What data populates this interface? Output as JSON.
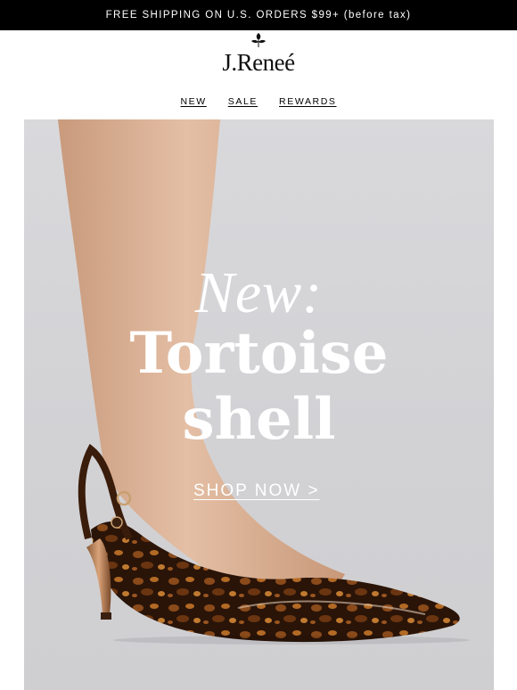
{
  "announcement": {
    "text": "FREE SHIPPING ON U.S. ORDERS $99+ (before tax)"
  },
  "brand": {
    "logo_text": "J.Reneé",
    "logo_icon": "leaf-icon"
  },
  "nav": {
    "items": [
      {
        "label": "NEW"
      },
      {
        "label": "SALE"
      },
      {
        "label": "REWARDS"
      }
    ]
  },
  "hero": {
    "eyebrow": "New:",
    "title_line1": "Tortoise",
    "title_line2": "shell",
    "cta": "SHOP NOW >",
    "image": "woman-leg-tortoiseshell-slingback-pump-photo"
  },
  "colors": {
    "announcement_bg": "#000000",
    "hero_bg": "#d6d6d9",
    "text_on_hero": "#ffffff"
  }
}
